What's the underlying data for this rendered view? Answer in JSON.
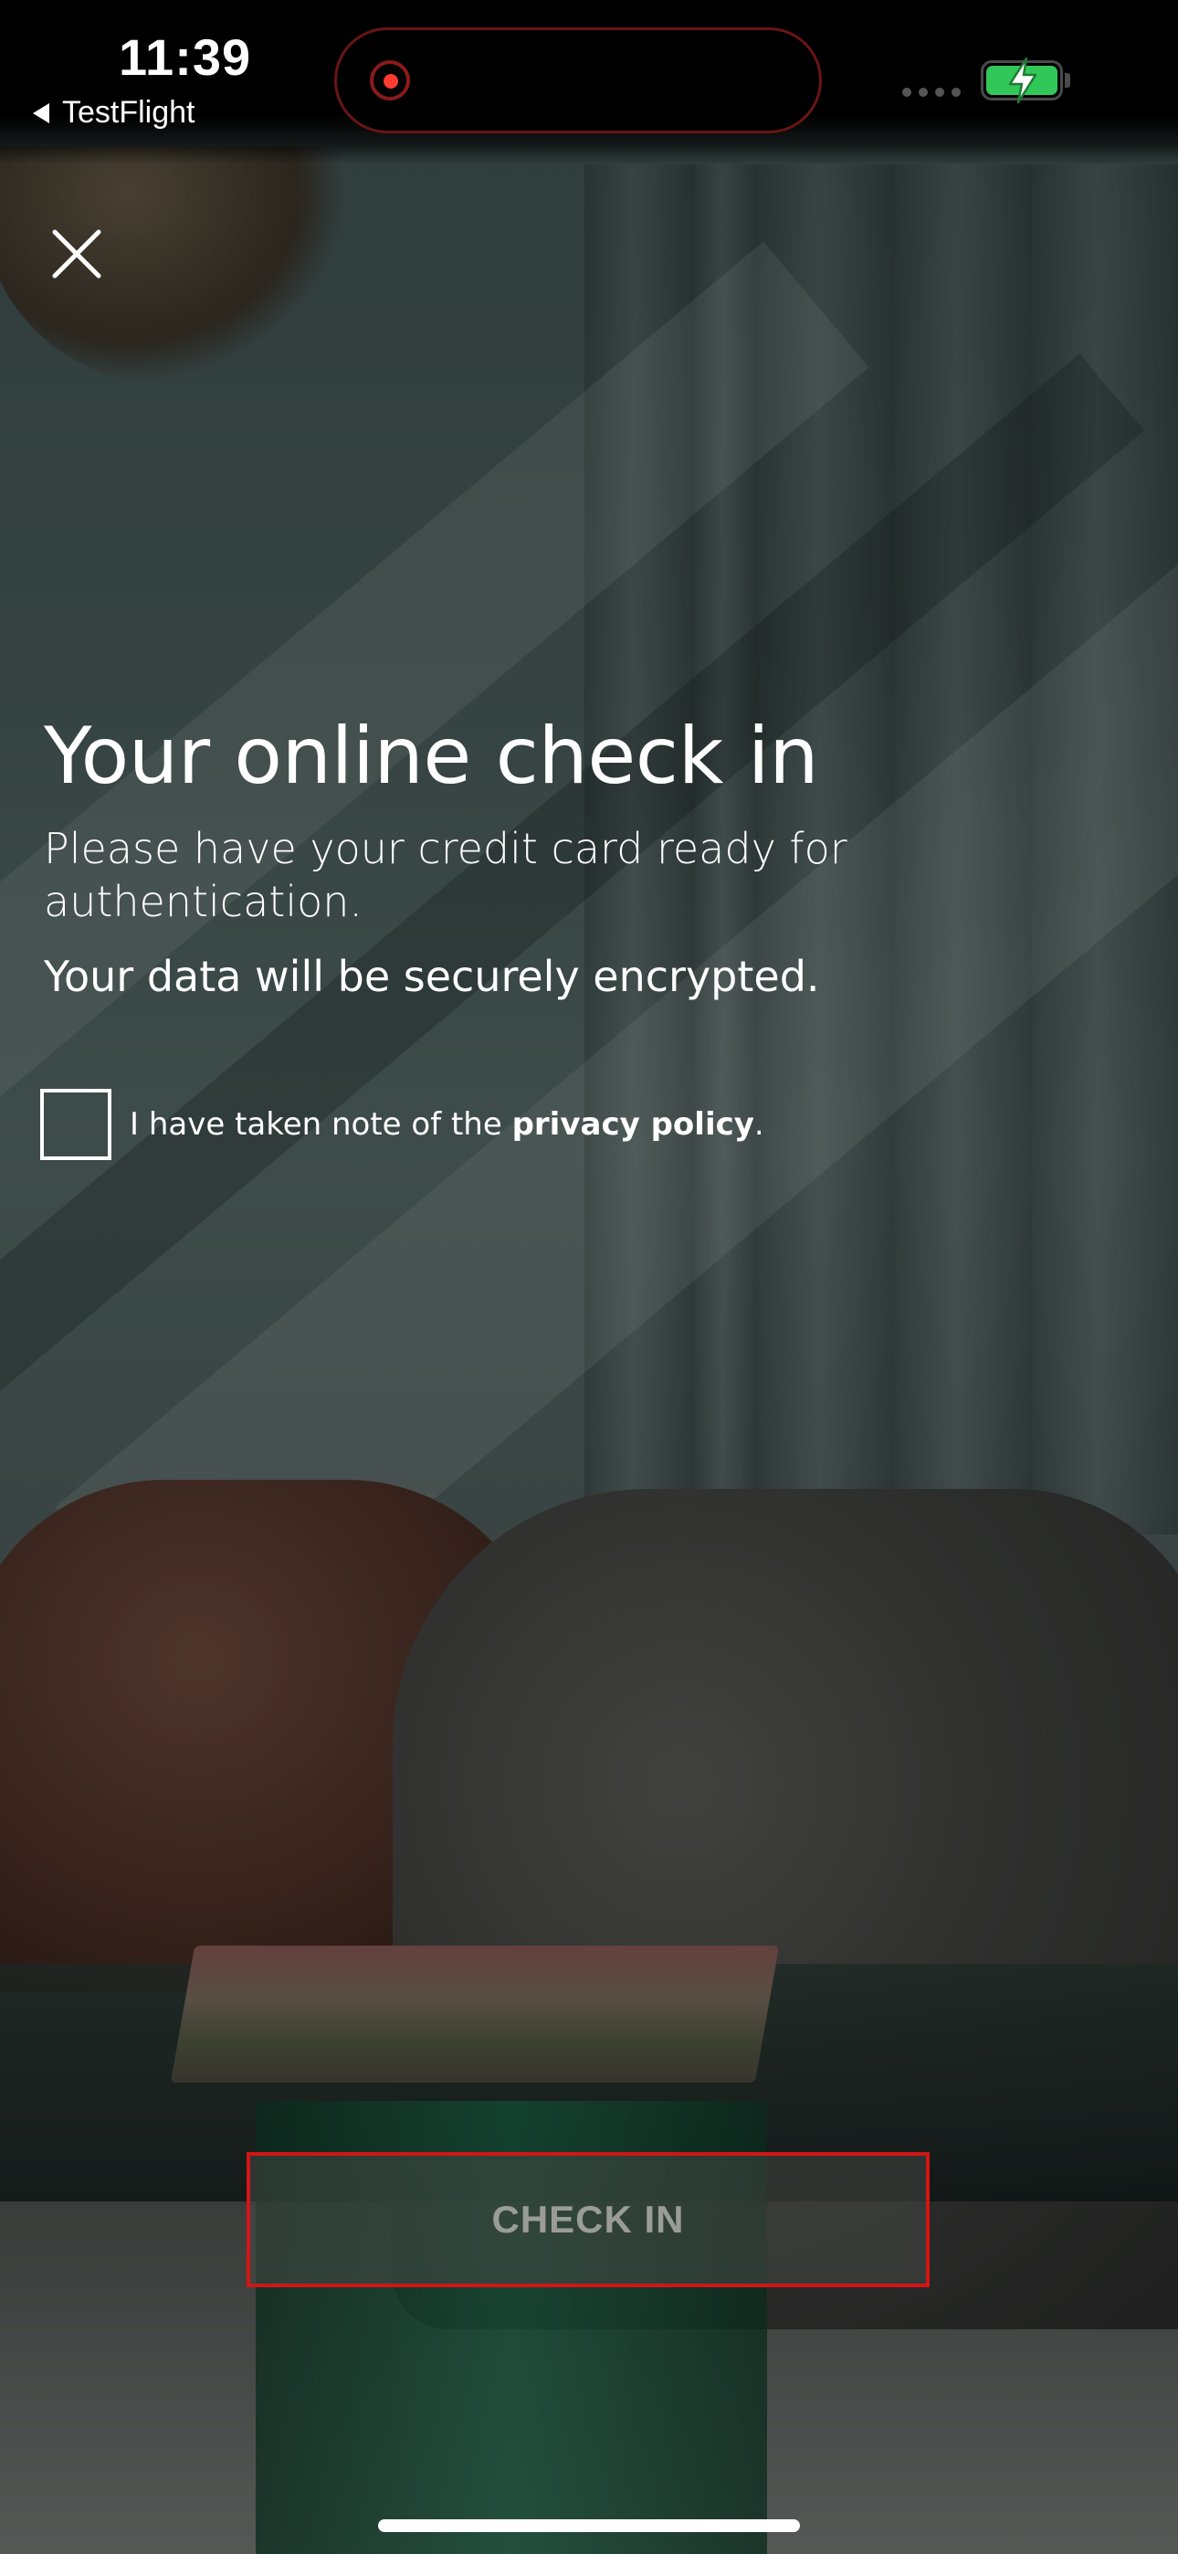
{
  "status_bar": {
    "time": "11:39",
    "back_app": "TestFlight",
    "battery_color": "#32c759",
    "recording_color": "#ff3b30"
  },
  "icons": {
    "close": "close-icon",
    "back": "back-triangle-icon",
    "battery": "battery-charging-icon",
    "recording": "recording-dot-icon"
  },
  "content": {
    "title": "Your online check in",
    "subtitle": "Please have your credit card ready for authentication.",
    "encrypted_note": "Your data will be securely encrypted."
  },
  "consent": {
    "prefix": "I have taken note of the ",
    "link": "privacy policy",
    "suffix": ".",
    "checked": false
  },
  "actions": {
    "check_in_label": "CHECK IN",
    "highlight_color": "#d01616"
  }
}
